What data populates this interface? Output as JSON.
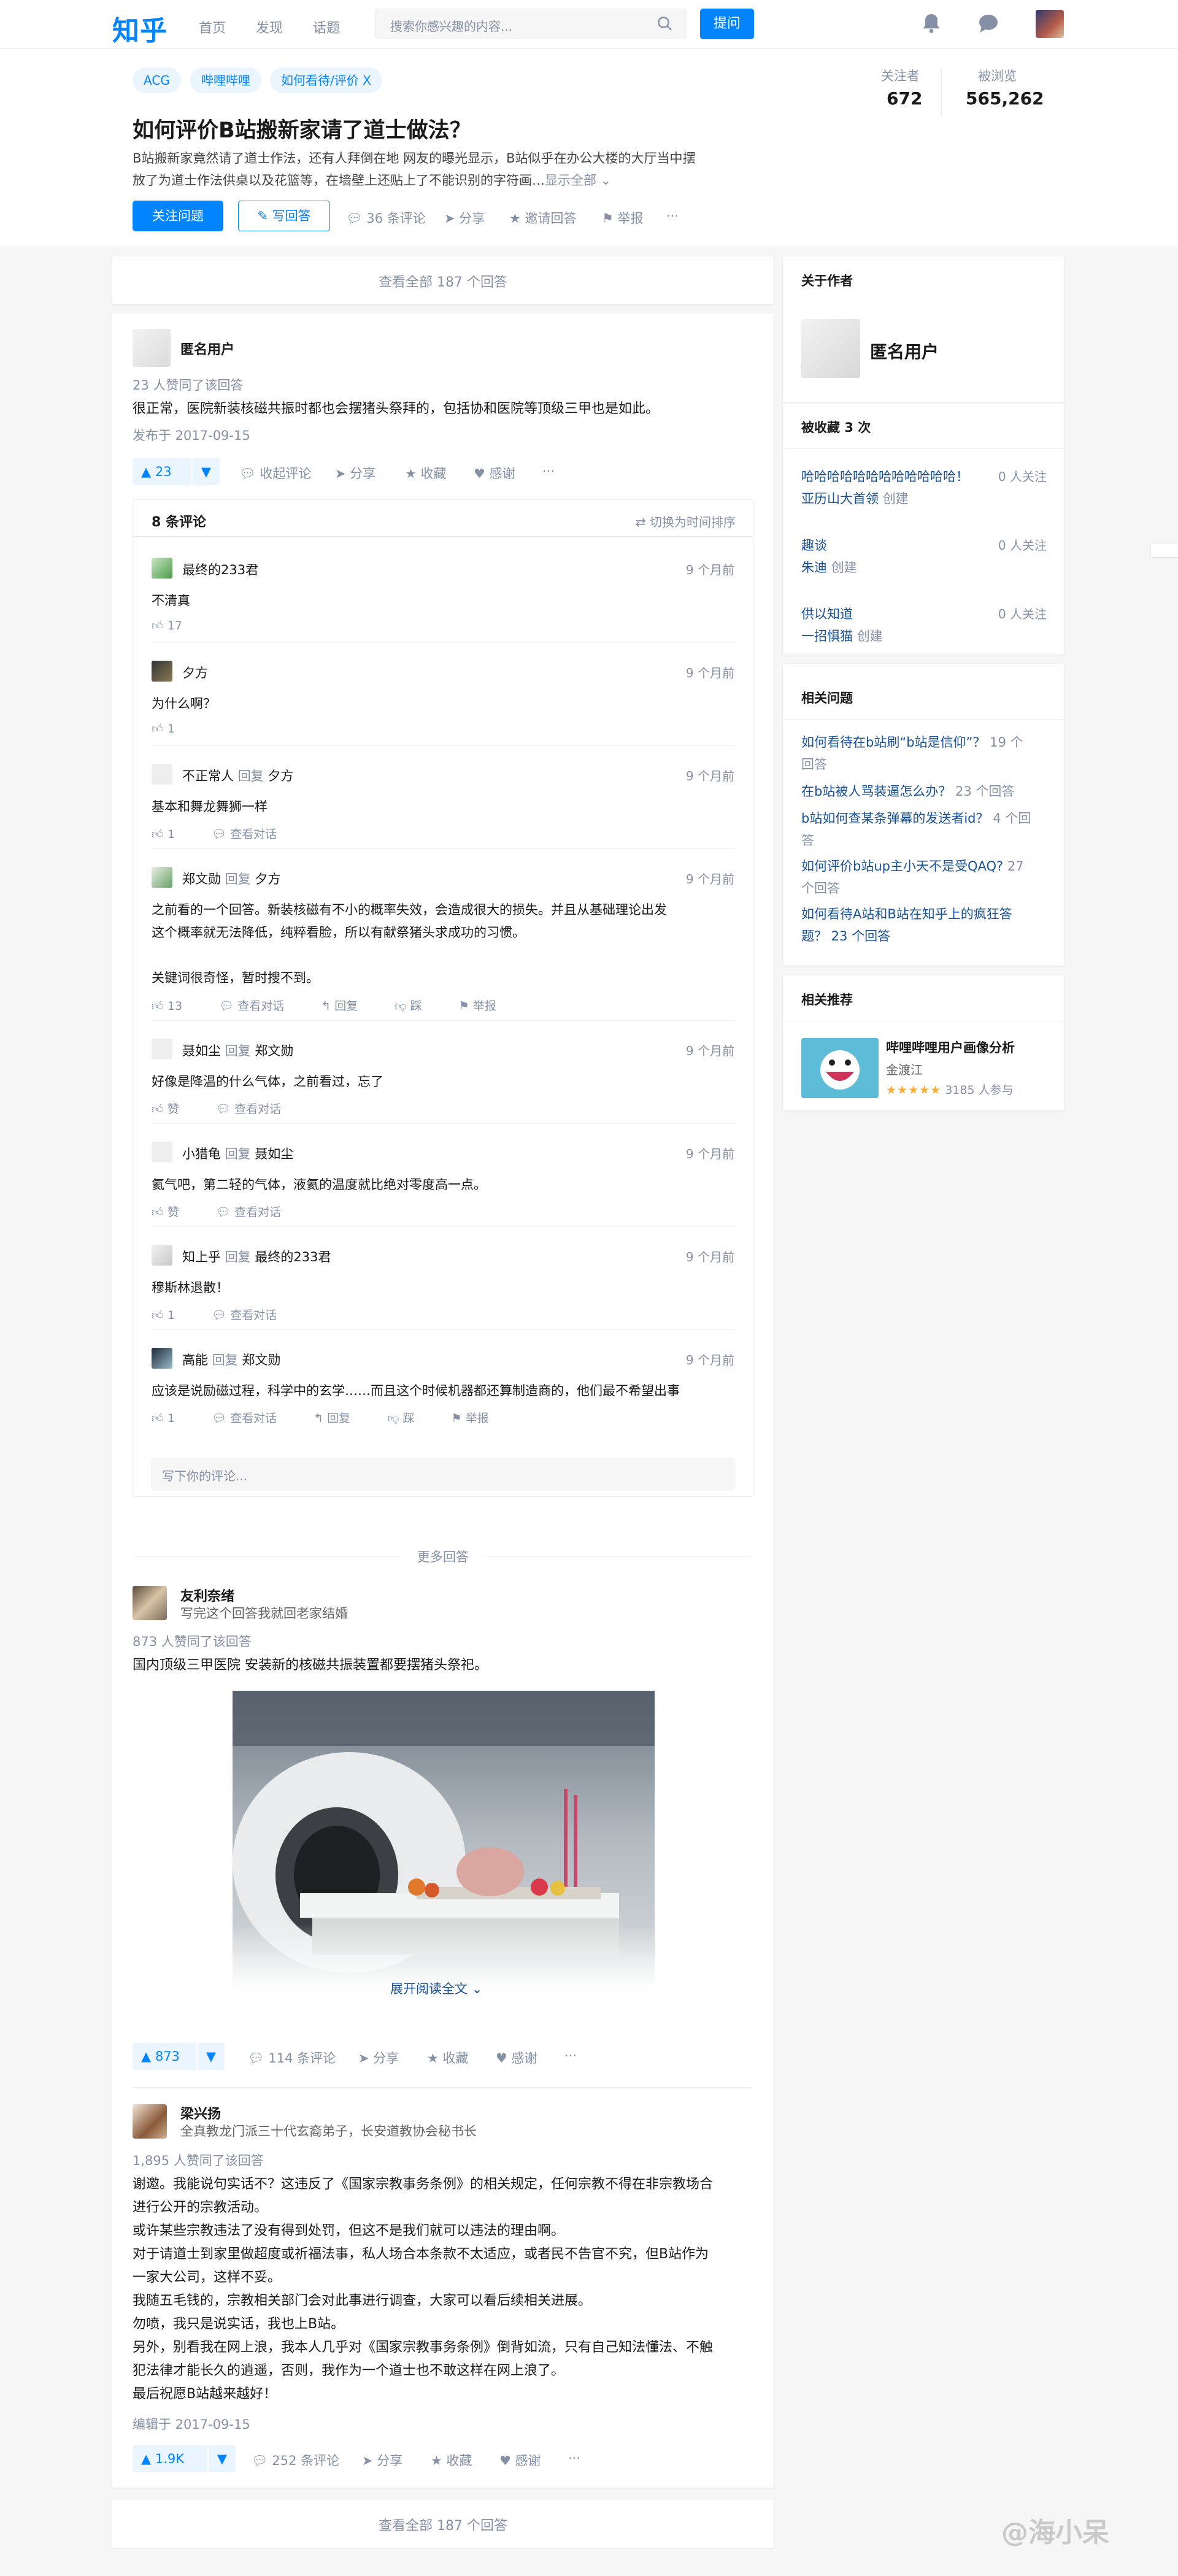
{
  "brand": {
    "logo": "知乎",
    "accent": "#0084ff"
  },
  "nav": {
    "links": [
      "首页",
      "发现",
      "话题"
    ],
    "search_placeholder": "搜索你感兴趣的内容...",
    "ask_label": "提问",
    "icons": [
      "search-icon",
      "bell-icon",
      "message-icon",
      "avatar"
    ]
  },
  "question": {
    "tags": [
      "ACG",
      "哔哩哔哩",
      "如何看待/评价 X"
    ],
    "title": "如何评价B站搬新家请了道士做法？",
    "detail_line1": "B站搬新家竟然请了道士作法，还有人拜倒在地 网友的曝光显示，B站似乎在办公大楼的大厅当中摆",
    "detail_line2": "放了为道士作法供桌以及花篮等，在墙壁上还贴上了不能识别的字符画…",
    "show_all": "显示全部",
    "follow_label": "关注问题",
    "write_label": "写回答",
    "comments": "36 条评论",
    "share": "分享",
    "invite": "邀请回答",
    "report": "举报",
    "more": "···",
    "followers_label": "关注者",
    "followers": "672",
    "views_label": "被浏览",
    "views": "565,262"
  },
  "view_all_top": "查看全部 187 个回答",
  "view_all_bottom": "查看全部 187 个回答",
  "answer1": {
    "author": "匿名用户",
    "upvoters": "23 人赞同了该回答",
    "content": "很正常，医院新装核磁共振时都也会摆猪头祭拜的，包括协和医院等顶级三甲也是如此。",
    "date": "发布于 2017-09-15",
    "votes": "23",
    "collapse_comments": "收起评论",
    "share": "分享",
    "collect": "收藏",
    "thanks": "感谢",
    "more": "···"
  },
  "comments": {
    "title": "8 条评论",
    "sort": "切换为时间排序",
    "reply_word": "回复",
    "view_dialog": "查看对话",
    "reply": "回复",
    "dislike": "踩",
    "report": "举报",
    "like_label": "赞",
    "input_placeholder": "写下你的评论...",
    "items": [
      {
        "name": "最终的233君",
        "reply_to": "",
        "time": "9 个月前",
        "text": "不清真",
        "likes": "17"
      },
      {
        "name": "夕方",
        "reply_to": "",
        "time": "9 个月前",
        "text": "为什么啊？",
        "likes": "1"
      },
      {
        "name": "不正常人",
        "reply_to": "夕方",
        "time": "9 个月前",
        "text": "基本和舞龙舞狮一样",
        "likes": "1"
      },
      {
        "name": "郑文勋",
        "reply_to": "夕方",
        "time": "9 个月前",
        "text1": "之前看的一个回答。新装核磁有不小的概率失效，会造成很大的损失。并且从基础理论出发",
        "text2": "这个概率就无法降低，纯粹看脸，所以有献祭猪头求成功的习惯。",
        "text3": "关键词很奇怪，暂时搜不到。",
        "likes": "13"
      },
      {
        "name": "聂如尘",
        "reply_to": "郑文勋",
        "time": "9 个月前",
        "text": "好像是降温的什么气体，之前看过，忘了",
        "likes": "赞"
      },
      {
        "name": "小猎龟",
        "reply_to": "聂如尘",
        "time": "9 个月前",
        "text": "氦气吧，第二轻的气体，液氦的温度就比绝对零度高一点。",
        "likes": "赞"
      },
      {
        "name": "知上乎",
        "reply_to": "最终的233君",
        "time": "9 个月前",
        "text": "穆斯林退散！",
        "likes": "1"
      },
      {
        "name": "高能",
        "reply_to": "郑文勋",
        "time": "9 个月前",
        "text": "应该是说励磁过程，科学中的玄学……而且这个时候机器都还算制造商的，他们最不希望出事",
        "likes": "1"
      }
    ]
  },
  "more_answers_label": "更多回答",
  "answer2": {
    "author": "友利奈绪",
    "bio": "写完这个回答我就回老家结婚",
    "upvoters": "873 人赞同了该回答",
    "content": "国内顶级三甲医院 安装新的核磁共振装置都要摆猪头祭祀。",
    "expand": "展开阅读全文",
    "votes": "873",
    "comments": "114 条评论",
    "share": "分享",
    "collect": "收藏",
    "thanks": "感谢",
    "more": "···"
  },
  "answer3": {
    "author": "梁兴扬",
    "bio": "全真教龙门派三十代玄裔弟子，长安道教协会秘书长",
    "upvoters": "1,895 人赞同了该回答",
    "lines": [
      "谢邀。我能说句实话不？这违反了《国家宗教事务条例》的相关规定，任何宗教不得在非宗教场合",
      "进行公开的宗教活动。",
      "或许某些宗教违法了没有得到处罚，但这不是我们就可以违法的理由啊。",
      "对于请道士到家里做超度或祈福法事，私人场合本条款不太适应，或者民不告官不究，但B站作为",
      "一家大公司，这样不妥。",
      "我随五毛钱的，宗教相关部门会对此事进行调查，大家可以看后续相关进展。",
      "勿喷，我只是说实话，我也上B站。",
      "另外，别看我在网上浪，我本人几乎对《国家宗教事务条例》倒背如流，只有自己知法懂法、不触",
      "犯法律才能长久的逍遥，否则，我作为一个道士也不敢这样在网上浪了。",
      "最后祝愿B站越来越好！"
    ],
    "date": "编辑于 2017-09-15",
    "votes": "1.9K",
    "comments": "252 条评论",
    "share": "分享",
    "collect": "收藏",
    "thanks": "感谢",
    "more": "···"
  },
  "sidebar": {
    "about_title": "关于作者",
    "author": "匿名用户",
    "collected_label": "被收藏",
    "collected_count": "3 次",
    "collections": [
      {
        "name": "哈哈哈哈哈哈哈哈哈哈哈哈！",
        "creator": "亚历山大首领",
        "created": "创建",
        "followers": "0 人关注"
      },
      {
        "name": "趣谈",
        "creator": "朱迪",
        "created": "创建",
        "followers": "0 人关注"
      },
      {
        "name": "供以知道",
        "creator": "一招惧猫",
        "created": "创建",
        "followers": "0 人关注"
      }
    ],
    "related_title": "相关问题",
    "related": [
      {
        "line1": "如何看待在b站刷“b站是信仰”？",
        "count_inline": "19 个",
        "line2": "回答"
      },
      {
        "line1": "在b站被人骂装逼怎么办？",
        "count_inline": "23 个回答",
        "line2": ""
      },
      {
        "line1": "b站如何查某条弹幕的发送者id？",
        "count_inline": "4 个回",
        "line2": "答"
      },
      {
        "line1": "如何评价b站up主小天不是受QAQ?",
        "count_inline": "27",
        "line2": "个回答"
      },
      {
        "line1": "如何看待A站和B站在知乎上的疯狂答",
        "count_inline": "",
        "line2": "题？ 23 个回答"
      }
    ],
    "recommend_title": "相关推荐",
    "recommend": {
      "title": "哔哩哔哩用户画像分析",
      "author": "金渡江",
      "stars": "★★★★★",
      "participants": "3185 人参与"
    }
  },
  "watermark": "@海小呆"
}
